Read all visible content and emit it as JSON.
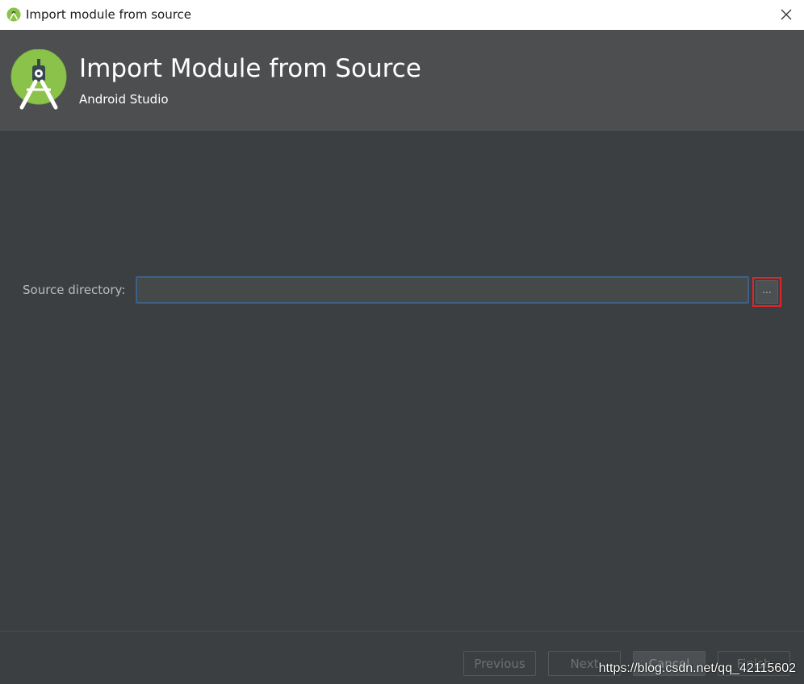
{
  "window": {
    "title": "Import module from source",
    "app_icon": "android-studio-icon",
    "close_icon": "close-icon"
  },
  "header": {
    "title": "Import Module from Source",
    "subtitle": "Android Studio",
    "logo_icon": "android-studio-logo"
  },
  "form": {
    "source_directory_label": "Source directory:",
    "source_directory_value": "",
    "browse_label": "..."
  },
  "footer": {
    "previous_label": "Previous",
    "next_label": "Next",
    "cancel_label": "Cancel",
    "finish_label": "Finish"
  },
  "watermark": "https://blog.csdn.net/qq_42115602",
  "colors": {
    "background": "#3c3f41",
    "header_bg": "#4d4e4f",
    "input_border": "#3d6185",
    "highlight": "#e0252b",
    "android_green": "#8bc34a"
  }
}
